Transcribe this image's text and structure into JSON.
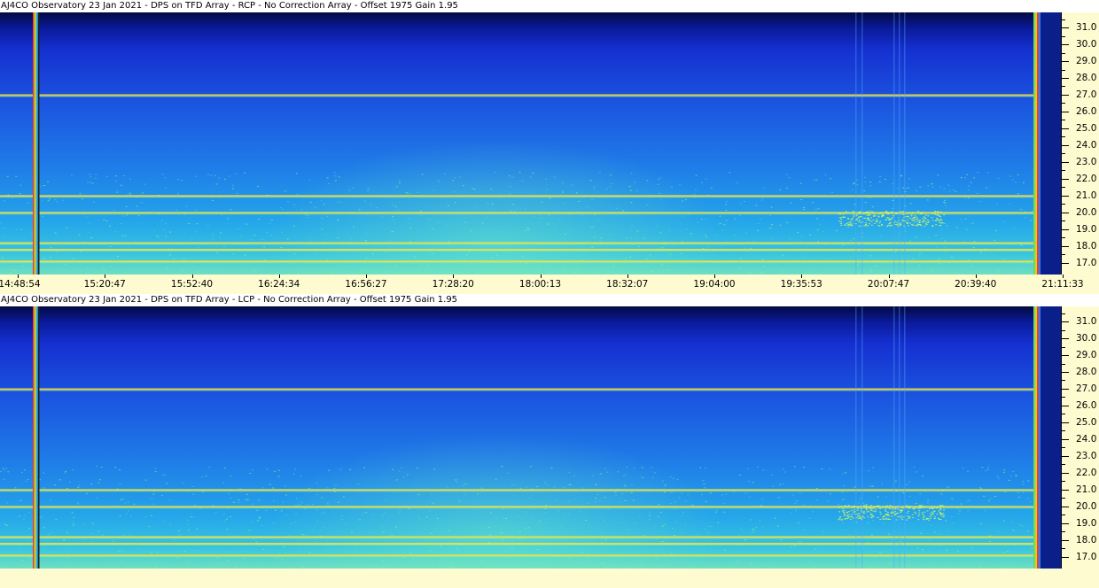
{
  "panels": [
    {
      "title": "AJ4CO Observatory 23 Jan 2021 - DPS on TFD Array  - RCP  -  No Correction Array  -  Offset 1975  Gain 1.95",
      "polarization": "RCP"
    },
    {
      "title": "AJ4CO Observatory 23 Jan 2021 - DPS on TFD Array  - LCP  -  No Correction Array  -  Offset 1975  Gain 1.95",
      "polarization": "LCP"
    }
  ],
  "freq_axis": {
    "unit": "MHz",
    "labels": [
      "31.0",
      "30.0",
      "29.0",
      "28.0",
      "27.0",
      "26.0",
      "25.0",
      "24.0",
      "23.0",
      "22.0",
      "21.0",
      "20.0",
      "19.0",
      "18.0",
      "17.0"
    ],
    "min": 16.3,
    "max": 31.9
  },
  "time_axis": {
    "labels": [
      "14:48:54",
      "15:20:47",
      "15:52:40",
      "16:24:34",
      "16:56:27",
      "17:28:20",
      "18:00:13",
      "18:32:07",
      "19:04:00",
      "19:35:53",
      "20:07:47",
      "20:39:40",
      "21:11:33"
    ]
  },
  "colors": {
    "background_low": "#1a3fd8",
    "background_mid": "#1f6fe8",
    "background_high": "#2fb0e6",
    "top_band": "#020a40",
    "interference_line": "#ffe040",
    "scale_bg": "#fffbd0"
  },
  "interference_freqs": [
    27.0,
    21.0,
    20.0,
    18.2,
    17.8,
    17.1
  ]
}
